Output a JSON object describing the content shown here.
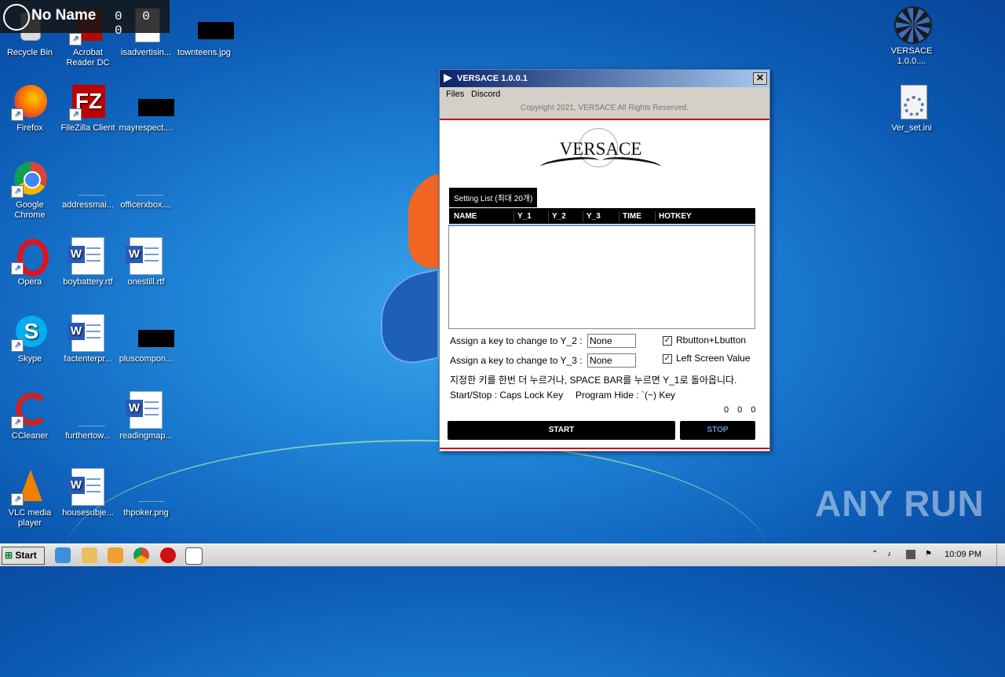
{
  "overlay": {
    "title": "No Name",
    "counter": "0 0 0"
  },
  "desktop_icons": [
    {
      "label": "Recycle Bin"
    },
    {
      "label": "Acrobat Reader DC"
    },
    {
      "label": "isadvertisin..."
    },
    {
      "label": "townteens.jpg"
    },
    {
      "label": "Firefox"
    },
    {
      "label": "FileZilla Client"
    },
    {
      "label": "mayrespect...."
    },
    {
      "label": "Google Chrome"
    },
    {
      "label": "addressmai..."
    },
    {
      "label": "officerxbox...."
    },
    {
      "label": "Opera"
    },
    {
      "label": "boybattery.rtf"
    },
    {
      "label": "onestill.rtf"
    },
    {
      "label": "Skype"
    },
    {
      "label": "factenterpr..."
    },
    {
      "label": "pluscompon..."
    },
    {
      "label": "CCleaner"
    },
    {
      "label": "furthertow..."
    },
    {
      "label": "readingmap..."
    },
    {
      "label": "VLC media player"
    },
    {
      "label": "housesubje..."
    },
    {
      "label": "thpoker.png"
    },
    {
      "label": "VERSACE 1.0.0...."
    },
    {
      "label": "Ver_set.ini"
    }
  ],
  "window": {
    "title": "VERSACE 1.0.0.1",
    "close": "✕",
    "menu": [
      "Files",
      "Discord"
    ],
    "copyright": "Copyright 2021, VERSACE All Rights Reserved.",
    "logo_text": "VERSACE",
    "tab_label": "Setting List (최대 20개)",
    "columns": [
      "NAME",
      "Y_1",
      "Y_2",
      "Y_3",
      "TIME",
      "HOTKEY"
    ],
    "assign_y2_label": "Assign a key to change to Y_2 :",
    "assign_y2_value": "None",
    "assign_y3_label": "Assign a key to change to Y_3 :",
    "assign_y3_value": "None",
    "rbutton_label": "Rbutton+Lbutton",
    "rbutton_checked": true,
    "leftscreen_label": "Left Screen Value",
    "leftscreen_checked": true,
    "info_korean": "지정한 키를 한번 더 누르거나, SPACE BAR를 누르면 Y_1로 돌아옵니다.",
    "start_stop_hint": "Start/Stop : Caps Lock Key",
    "hide_hint": "Program Hide : `(~) Key",
    "counter": "0 0 0",
    "start_button": "START",
    "stop_button": "STOP"
  },
  "watermark": "ANY RUN",
  "taskbar": {
    "start_label": "Start",
    "clock": "10:09 PM"
  }
}
